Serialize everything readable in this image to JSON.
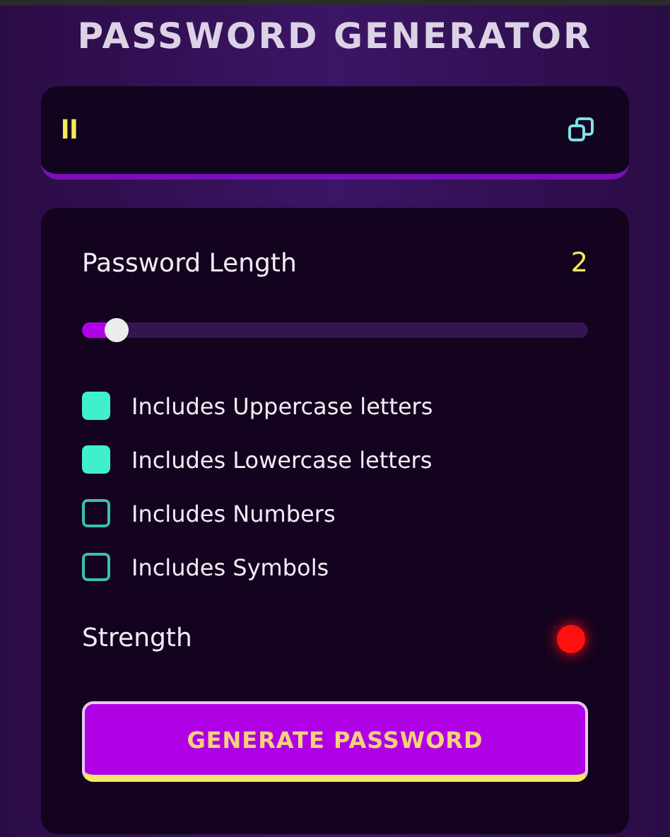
{
  "title": "PASSWORD GENERATOR",
  "output": {
    "value": "ll"
  },
  "length": {
    "label": "Password Length",
    "value": "2",
    "level": 0.07
  },
  "options": [
    {
      "label": "Includes Uppercase letters",
      "checked": true
    },
    {
      "label": "Includes Lowercase letters",
      "checked": true
    },
    {
      "label": "Includes Numbers",
      "checked": false
    },
    {
      "label": "Includes Symbols",
      "checked": false
    }
  ],
  "strength": {
    "label": "Strength",
    "color": "#ff1010"
  },
  "button": {
    "label": "GENERATE PASSWORD"
  }
}
